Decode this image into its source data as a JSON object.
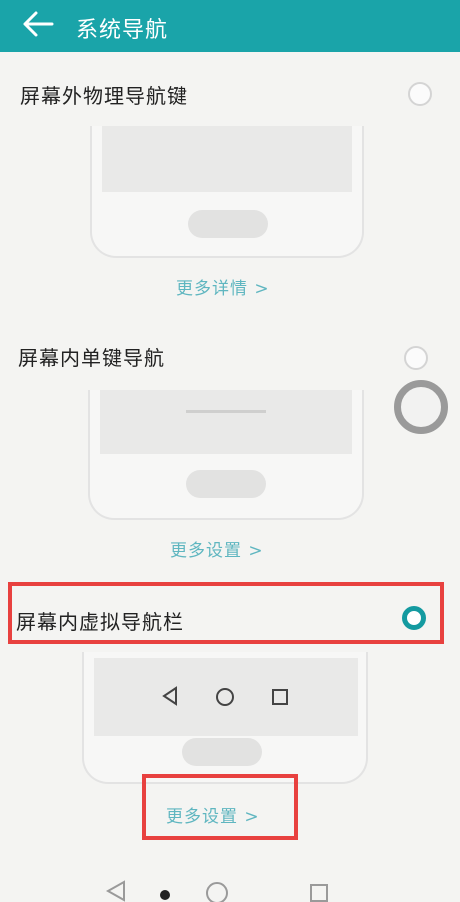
{
  "header": {
    "back_icon": "arrow-left-icon",
    "title": "系统导航"
  },
  "options": [
    {
      "label": "屏幕外物理导航键",
      "selected": false,
      "link": "更多详情 >"
    },
    {
      "label": "屏幕内单键导航",
      "selected": false,
      "link": "更多设置 >"
    },
    {
      "label": "屏幕内虚拟导航栏",
      "selected": true,
      "link": "更多设置 >"
    }
  ],
  "virtual_nav_icons": [
    "back-triangle-icon",
    "home-circle-icon",
    "recent-square-icon"
  ],
  "colors": {
    "accent": "#1aa4a9",
    "highlight": "#e8413f",
    "link": "#5fb6c0"
  }
}
